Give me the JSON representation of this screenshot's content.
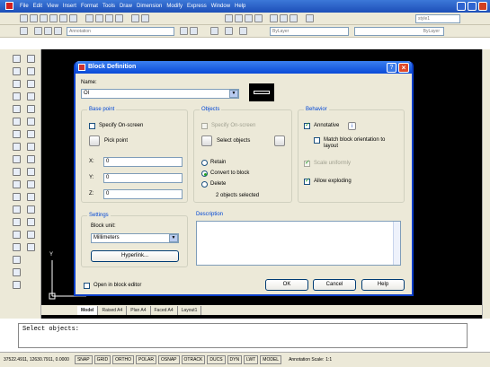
{
  "app": {
    "menu": [
      "File",
      "Edit",
      "View",
      "Insert",
      "Format",
      "Tools",
      "Draw",
      "Dimension",
      "Modify",
      "Express",
      "Window",
      "Help"
    ],
    "style_combo": "style1"
  },
  "toolbar2": {
    "workspace_combo": "Annotation",
    "layer_bylayer": "ByLayer",
    "line_bylayer": "ByLayer"
  },
  "dialog": {
    "title": "Block Definition",
    "name_label": "Name:",
    "name_value": "Ol",
    "base_point": {
      "title": "Base point",
      "specify_on_screen": "Specify On-screen",
      "pick_point": "Pick point",
      "x_label": "X:",
      "x_value": "0",
      "y_label": "Y:",
      "y_value": "0",
      "z_label": "Z:",
      "z_value": "0"
    },
    "objects": {
      "title": "Objects",
      "specify_on_screen": "Specify On-screen",
      "select_objects": "Select objects",
      "retain": "Retain",
      "convert": "Convert to block",
      "delete": "Delete",
      "status": "2 objects selected"
    },
    "behavior": {
      "title": "Behavior",
      "annotative": "Annotative",
      "match_orientation": "Match block orientation to layout",
      "scale_uniformly": "Scale uniformly",
      "allow_exploding": "Allow exploding"
    },
    "settings": {
      "title": "Settings",
      "block_unit_label": "Block unit:",
      "block_unit_value": "Millimeters",
      "hyperlink": "Hyperlink..."
    },
    "description_label": "Description",
    "open_in_editor": "Open in block editor",
    "ok": "OK",
    "cancel": "Cancel",
    "help": "Help"
  },
  "tabs": [
    "Model",
    "Raised A4",
    "Plan A4",
    "Faced A4",
    "Layout1"
  ],
  "ucs": {
    "y": "Y",
    "x": "X"
  },
  "command": {
    "text": "Select objects:"
  },
  "status": {
    "coords": "37522.4911, 12630.7911, 0.0000",
    "buttons": [
      "SNAP",
      "GRID",
      "ORTHO",
      "POLAR",
      "OSNAP",
      "OTRACK",
      "DUCS",
      "DYN",
      "LWT",
      "MODEL"
    ],
    "annotation_scale_label": "Annotation Scale:",
    "annotation_scale_value": "1:1"
  },
  "colors": {
    "title_blue": "#1d4fb8",
    "dialog_bg": "#ece9d8",
    "canvas": "#000000"
  }
}
